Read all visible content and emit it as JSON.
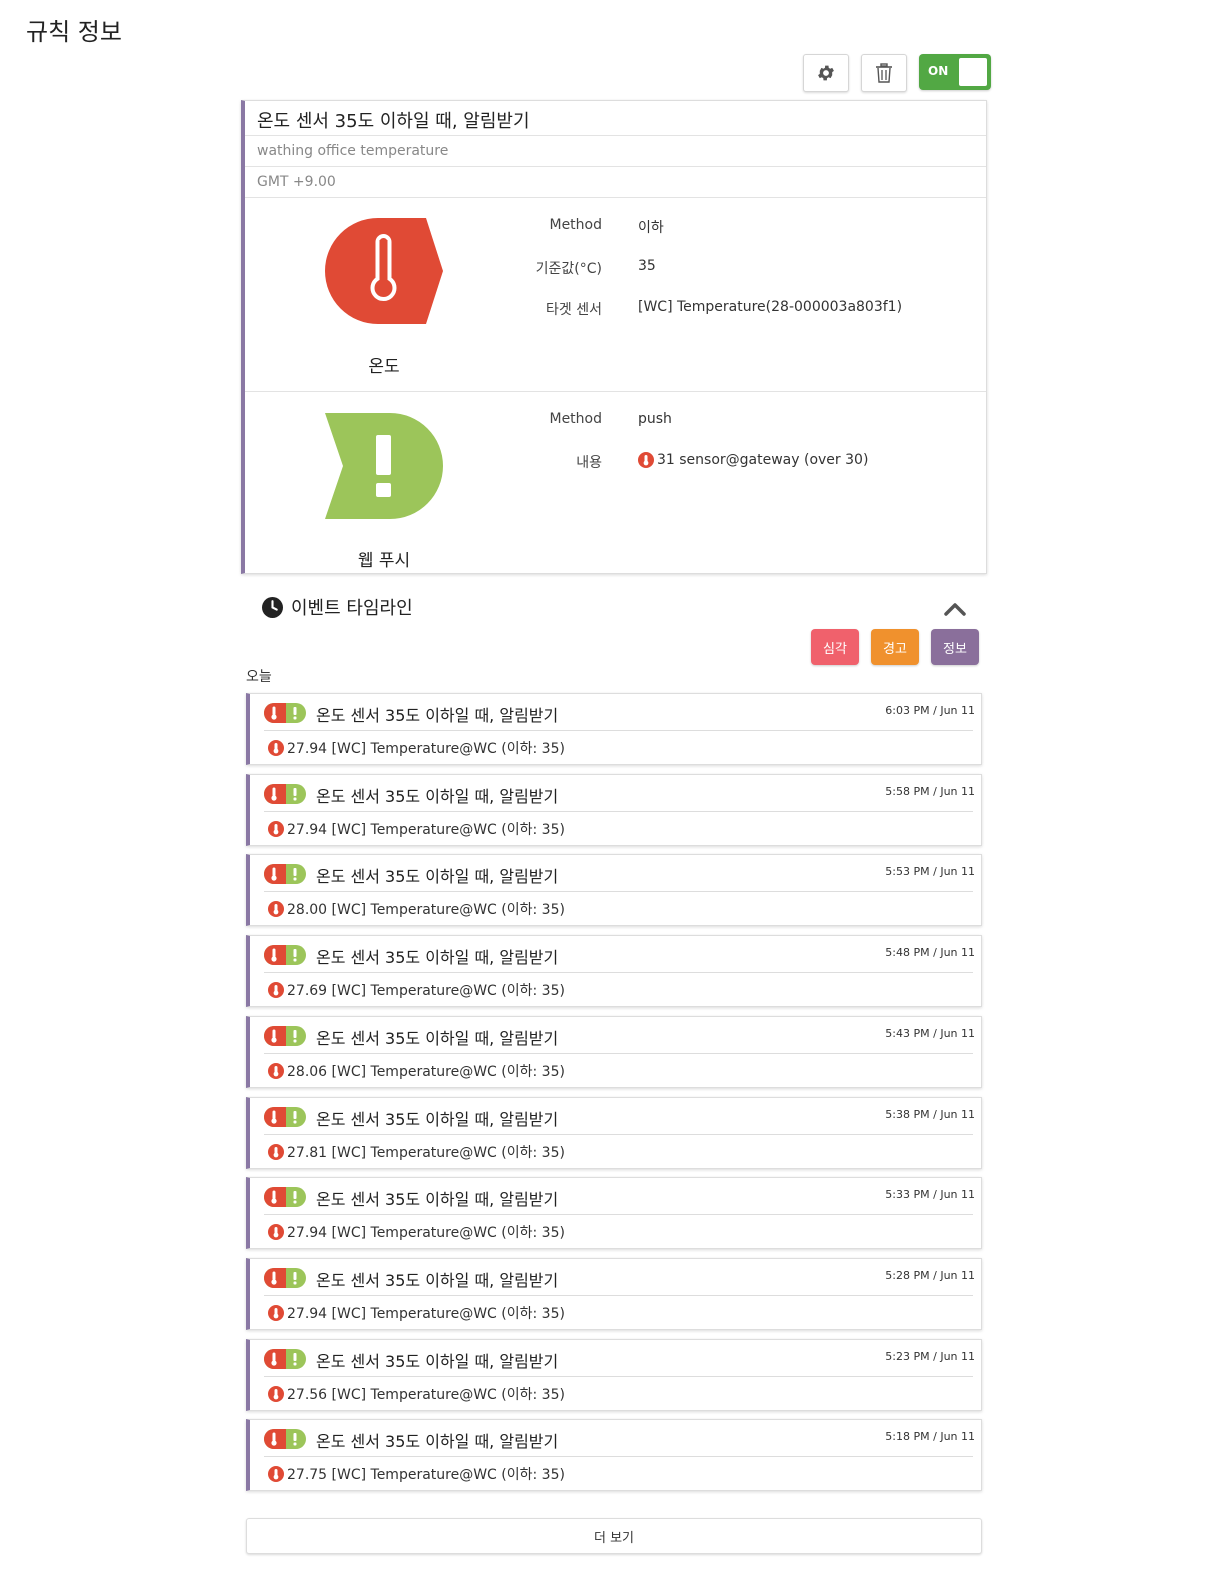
{
  "page": {
    "title": "규칙 정보"
  },
  "toolbar": {
    "toggle_label": "ON"
  },
  "rule": {
    "name": "온도 센서 35도 이하일 때, 알림받기",
    "description": "wathing office temperature",
    "timezone": "GMT +9.00",
    "condition": {
      "label": "온도",
      "icon": "thermometer-icon",
      "color": "#e04a35",
      "props": [
        {
          "key": "Method",
          "value": "이하"
        },
        {
          "key": "기준값(°C)",
          "value": "35"
        },
        {
          "key": "타겟 센서",
          "value": "[WC] Temperature(28-000003a803f1)"
        }
      ]
    },
    "action": {
      "label": "웹 푸시",
      "icon": "exclamation-icon",
      "color": "#9cc55a",
      "props": [
        {
          "key": "Method",
          "value": "push"
        },
        {
          "key": "내용",
          "value": "31 sensor@gateway (over 30)"
        }
      ]
    }
  },
  "timeline": {
    "title": "이벤트 타임라인",
    "filters": {
      "critical": "심각",
      "warning": "경고",
      "info": "정보"
    },
    "group_label": "오늘",
    "more_label": "더 보기",
    "events": [
      {
        "title": "온도 센서 35도 이하일 때, 알림받기",
        "time": "6:03 PM / Jun 11",
        "message": "27.94 [WC] Temperature@WC (이하: 35)"
      },
      {
        "title": "온도 센서 35도 이하일 때, 알림받기",
        "time": "5:58 PM / Jun 11",
        "message": "27.94 [WC] Temperature@WC (이하: 35)"
      },
      {
        "title": "온도 센서 35도 이하일 때, 알림받기",
        "time": "5:53 PM / Jun 11",
        "message": "28.00 [WC] Temperature@WC (이하: 35)"
      },
      {
        "title": "온도 센서 35도 이하일 때, 알림받기",
        "time": "5:48 PM / Jun 11",
        "message": "27.69 [WC] Temperature@WC (이하: 35)"
      },
      {
        "title": "온도 센서 35도 이하일 때, 알림받기",
        "time": "5:43 PM / Jun 11",
        "message": "28.06 [WC] Temperature@WC (이하: 35)"
      },
      {
        "title": "온도 센서 35도 이하일 때, 알림받기",
        "time": "5:38 PM / Jun 11",
        "message": "27.81 [WC] Temperature@WC (이하: 35)"
      },
      {
        "title": "온도 센서 35도 이하일 때, 알림받기",
        "time": "5:33 PM / Jun 11",
        "message": "27.94 [WC] Temperature@WC (이하: 35)"
      },
      {
        "title": "온도 센서 35도 이하일 때, 알림받기",
        "time": "5:28 PM / Jun 11",
        "message": "27.94 [WC] Temperature@WC (이하: 35)"
      },
      {
        "title": "온도 센서 35도 이하일 때, 알림받기",
        "time": "5:23 PM / Jun 11",
        "message": "27.56 [WC] Temperature@WC (이하: 35)"
      },
      {
        "title": "온도 센서 35도 이하일 때, 알림받기",
        "time": "5:18 PM / Jun 11",
        "message": "27.75 [WC] Temperature@WC (이하: 35)"
      }
    ]
  }
}
